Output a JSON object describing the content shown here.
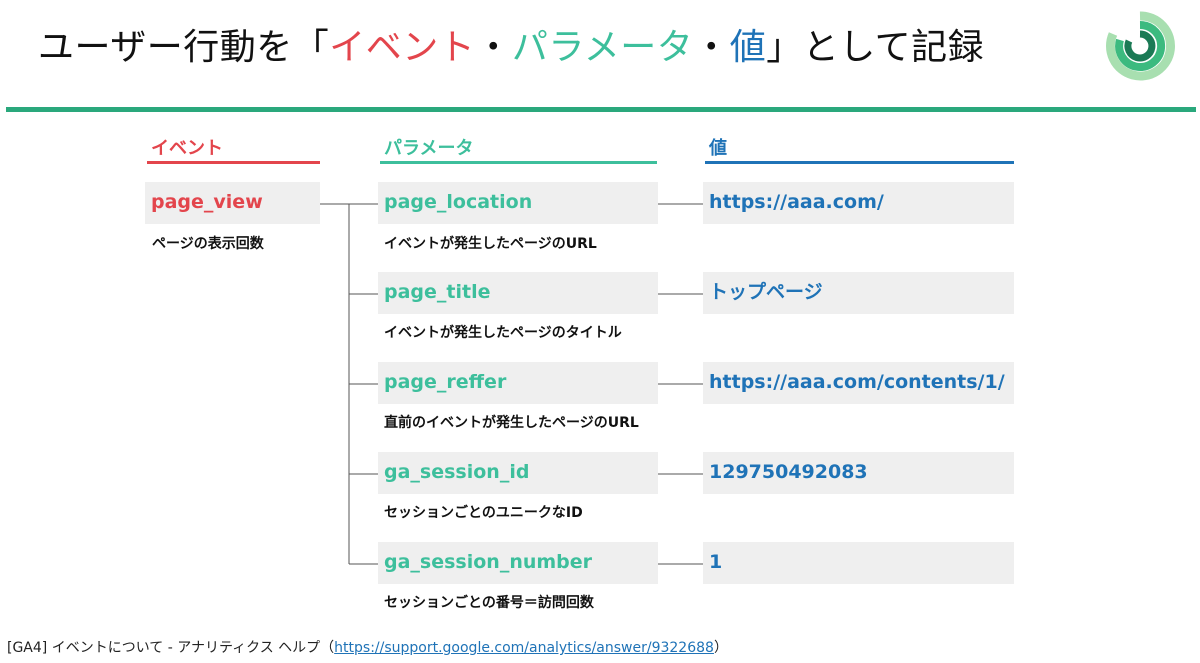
{
  "title": {
    "prefix": "ユーザー行動を「",
    "event": "イベント",
    "sep1": "・",
    "parameter": "パラメータ",
    "sep2": "・",
    "value": "値",
    "suffix": "」として記録"
  },
  "columns": {
    "event": "イベント",
    "parameter": "パラメータ",
    "value": "値"
  },
  "event": {
    "name": "page_view",
    "description": "ページの表示回数"
  },
  "rows": [
    {
      "param": "page_location",
      "description": "イベントが発生したページのURL",
      "value": "https://aaa.com/"
    },
    {
      "param": "page_title",
      "description": "イベントが発生したページのタイトル",
      "value": "トップページ"
    },
    {
      "param": "page_reffer",
      "description": "直前のイベントが発生したページのURL",
      "value": "https://aaa.com/contents/1/"
    },
    {
      "param": "ga_session_id",
      "description": "セッションごとのユニークなID",
      "value": "129750492083"
    },
    {
      "param": "ga_session_number",
      "description": "セッションごとの番号＝訪問回数",
      "value": "1"
    }
  ],
  "footer": {
    "text": "[GA4] イベントについて - アナリティクス ヘルプ（",
    "link": "https://support.google.com/analytics/answer/9322688",
    "close": "）"
  },
  "colors": {
    "event": "#e3454c",
    "parameter": "#3dbf9c",
    "value": "#1f73b7",
    "rule": "#2aa87c"
  },
  "icons": {
    "logo": "ring-logo-icon"
  }
}
